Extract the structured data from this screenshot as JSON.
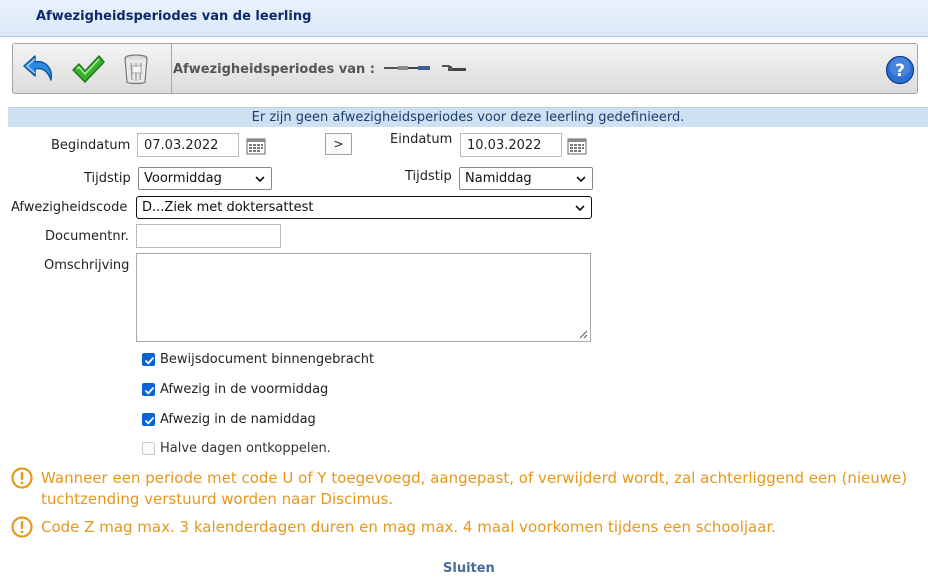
{
  "window": {
    "title": "Afwezigheidsperiodes van de leerling"
  },
  "toolbar": {
    "undo_icon": "undo-arrow-icon",
    "save_icon": "checkmark-icon",
    "delete_icon": "trash-can-icon",
    "title": "Afwezigheidsperiodes van :",
    "help_icon": "question-mark-icon"
  },
  "info": {
    "message": "Er zijn geen afwezigheidsperiodes voor deze leerling gedefinieerd."
  },
  "form": {
    "begindatum_label": "Begindatum",
    "begindatum_value": "07.03.2022",
    "copy_button_label": ">",
    "einddatum_label": "Eindatum",
    "einddatum_value": "10.03.2022",
    "tijdstip_begin_label": "Tijdstip",
    "tijdstip_begin_value": "Voormiddag",
    "tijdstip_eind_label": "Tijdstip",
    "tijdstip_eind_value": "Namiddag",
    "code_label": "Afwezigheidscode",
    "code_value": "D...Ziek met doktersattest",
    "documentnr_label": "Documentnr.",
    "documentnr_value": "",
    "omschrijving_label": "Omschrijving",
    "omschrijving_value": ""
  },
  "checkboxes": [
    {
      "label": "Bewijsdocument binnengebracht",
      "checked": true,
      "disabled": false
    },
    {
      "label": "Afwezig in de voormiddag",
      "checked": true,
      "disabled": false
    },
    {
      "label": "Afwezig in de namiddag",
      "checked": true,
      "disabled": false
    },
    {
      "label": "Halve dagen ontkoppelen.",
      "checked": false,
      "disabled": true
    }
  ],
  "warnings": [
    {
      "text": "Wanneer een periode met code U of Y toegevoegd, aangepast, of verwijderd wordt, zal achterliggend een (nieuwe) tuchtzending verstuurd worden naar Discimus."
    },
    {
      "text": "Code Z mag max. 3 kalenderdagen duren en mag max. 4 maal voorkomen tijdens een schooljaar."
    }
  ],
  "footer": {
    "close_label": "Sluiten"
  },
  "colors": {
    "title": "#0e2a6b",
    "info_bar": "#cfe0f3",
    "warning": "#e6971c",
    "checkbox": "#0a63d6",
    "link": "#4a6a9a"
  }
}
